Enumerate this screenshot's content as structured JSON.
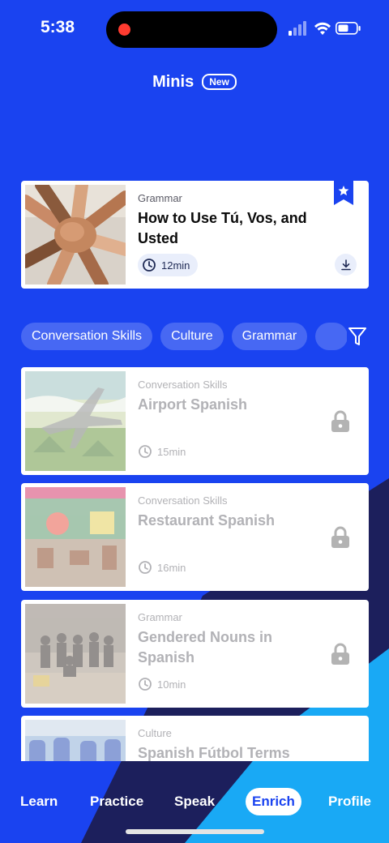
{
  "status_bar": {
    "time": "5:38"
  },
  "header": {
    "title": "Minis",
    "badge": "New"
  },
  "featured": {
    "category": "Grammar",
    "title": "How to Use Tú, Vos, and Usted",
    "duration": "12min"
  },
  "chips": [
    "Conversation Skills",
    "Culture",
    "Grammar"
  ],
  "lessons": [
    {
      "category": "Conversation Skills",
      "title": "Airport Spanish",
      "duration": "15min"
    },
    {
      "category": "Conversation Skills",
      "title": "Restaurant Spanish",
      "duration": "16min"
    },
    {
      "category": "Grammar",
      "title": "Gendered Nouns in Spanish",
      "duration": "10min"
    },
    {
      "category": "Culture",
      "title": "Spanish Fútbol Terms",
      "duration": ""
    }
  ],
  "nav": {
    "items": [
      "Learn",
      "Practice",
      "Speak",
      "Enrich",
      "Profile"
    ],
    "active": "Enrich"
  },
  "colors": {
    "background": "#1a43f0",
    "dark_shape": "#1c1f5c",
    "light_shape": "#19a9f5",
    "card": "#ffffff"
  },
  "icons": [
    "clock-icon",
    "lock-icon",
    "bookmark-star-icon",
    "download-icon",
    "filter-icon",
    "wifi-icon",
    "battery-icon",
    "signal-icon"
  ]
}
